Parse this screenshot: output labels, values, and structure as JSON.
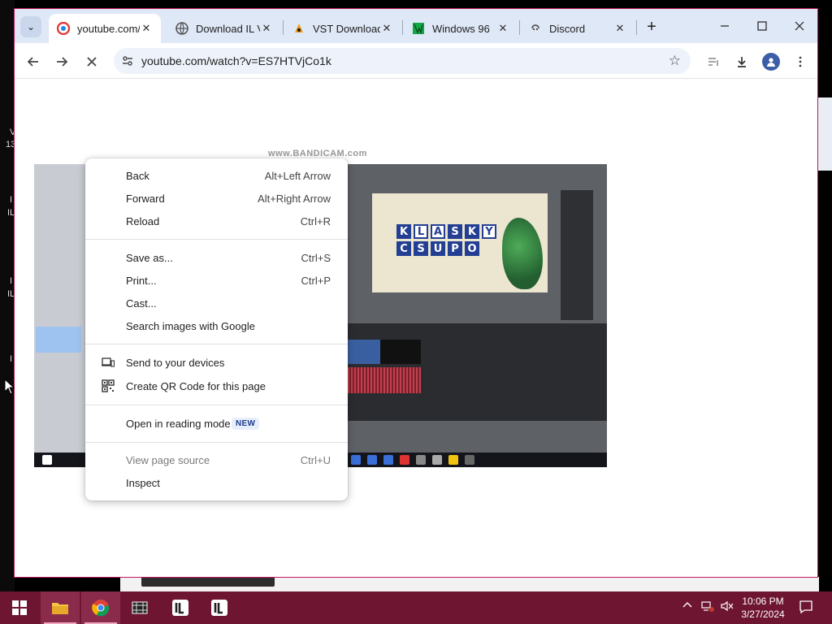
{
  "desktop": {
    "labels": [
      "V",
      "13",
      "I",
      "IL",
      "I",
      "IL",
      "I"
    ]
  },
  "browser": {
    "tabs": [
      {
        "title": "youtube.com/",
        "favicon": "youtube-icon",
        "active": true
      },
      {
        "title": "Download IL V",
        "favicon": "chrome-icon",
        "active": false
      },
      {
        "title": "VST Download",
        "favicon": "fl-studio-icon",
        "active": false
      },
      {
        "title": "Windows 96",
        "favicon": "windows96-icon",
        "active": false
      },
      {
        "title": "Discord",
        "favicon": "discord-icon",
        "active": false
      }
    ],
    "url": "youtube.com/watch?v=ES7HTVjCo1k",
    "new_tab_symbol": "+",
    "window_controls": {
      "minimize": "—",
      "maximize": "☐",
      "close": "✕"
    }
  },
  "video": {
    "watermark": "www.BANDICAM.com",
    "logo_top": [
      "K",
      "L",
      "A",
      "S",
      "K",
      "Y"
    ],
    "logo_bottom": [
      "C",
      "S",
      "U",
      "P",
      "O"
    ]
  },
  "context_menu": {
    "groups": [
      [
        {
          "label": "Back",
          "shortcut": "Alt+Left Arrow"
        },
        {
          "label": "Forward",
          "shortcut": "Alt+Right Arrow"
        },
        {
          "label": "Reload",
          "shortcut": "Ctrl+R"
        }
      ],
      [
        {
          "label": "Save as...",
          "shortcut": "Ctrl+S"
        },
        {
          "label": "Print...",
          "shortcut": "Ctrl+P"
        },
        {
          "label": "Cast...",
          "shortcut": ""
        },
        {
          "label": "Search images with Google",
          "shortcut": ""
        }
      ],
      [
        {
          "label": "Send to your devices",
          "icon": "devices-icon"
        },
        {
          "label": "Create QR Code for this page",
          "icon": "qr-code-icon"
        }
      ],
      [
        {
          "label": "Open in reading mode",
          "badge": "NEW"
        }
      ],
      [
        {
          "label": "View page source",
          "shortcut": "Ctrl+U",
          "disabled": true
        },
        {
          "label": "Inspect",
          "shortcut": ""
        }
      ]
    ]
  },
  "taskbar": {
    "time": "10:06 PM",
    "date": "3/27/2024",
    "apps": [
      "start-icon",
      "file-explorer-icon",
      "chrome-icon",
      "video-editor-icon",
      "fl-studio-icon",
      "fl-studio-icon"
    ],
    "colors": {
      "bar": "#6e1532",
      "active": "#8b2b4b"
    }
  }
}
